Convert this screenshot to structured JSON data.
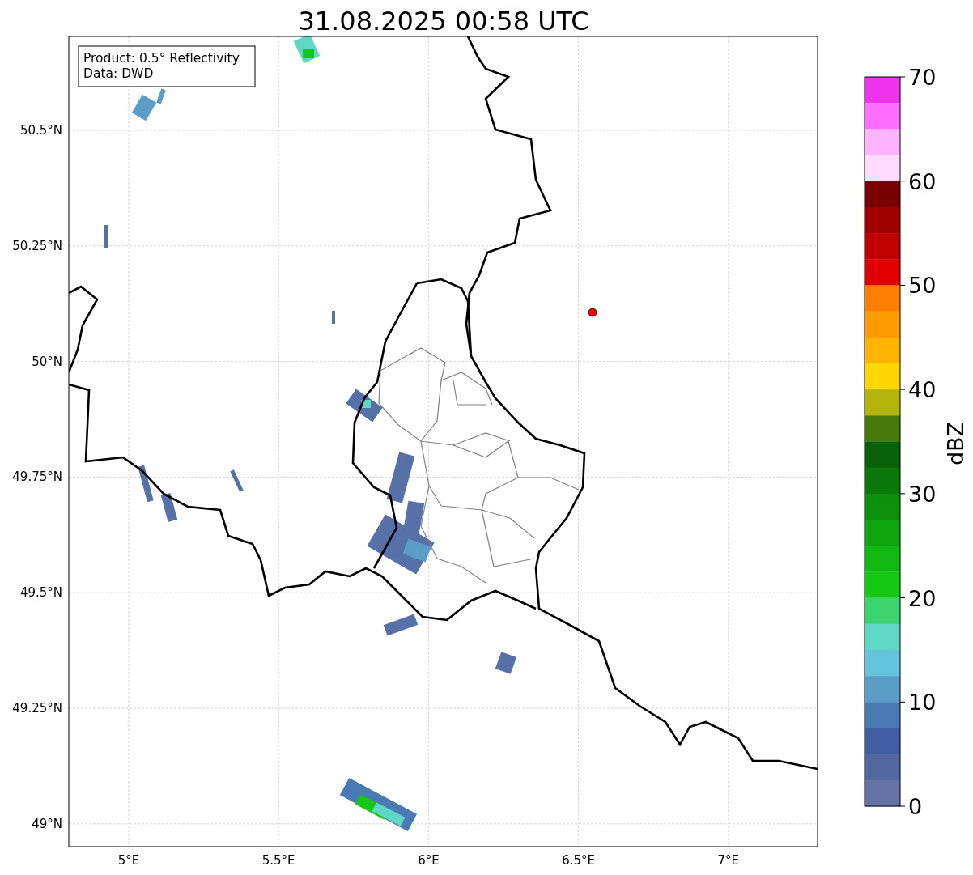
{
  "title": "31.08.2025 00:58 UTC",
  "info_box": {
    "lines": [
      "Product: 0.5° Reflectivity",
      "Data: DWD"
    ]
  },
  "map": {
    "x_ticks": [
      "5°E",
      "5.5°E",
      "6°E",
      "6.5°E",
      "7°E"
    ],
    "y_ticks": [
      "50.5°N",
      "50.25°N",
      "50°N",
      "49.75°N",
      "49.5°N",
      "49.25°N",
      "49°N"
    ]
  },
  "colorbar": {
    "label": "dBZ",
    "ticks": [
      "70",
      "60",
      "50",
      "40",
      "30",
      "20",
      "10",
      "0"
    ],
    "bins": [
      {
        "color": "#ee32ee"
      },
      {
        "color": "#ff6eff"
      },
      {
        "color": "#ffb4ff"
      },
      {
        "color": "#ffdcff"
      },
      {
        "color": "#780000"
      },
      {
        "color": "#a00000"
      },
      {
        "color": "#c00000"
      },
      {
        "color": "#e10000"
      },
      {
        "color": "#ff7d00"
      },
      {
        "color": "#ff9b00"
      },
      {
        "color": "#ffb400"
      },
      {
        "color": "#ffd700"
      },
      {
        "color": "#b4b40a"
      },
      {
        "color": "#467a0a"
      },
      {
        "color": "#086008"
      },
      {
        "color": "#0a780a"
      },
      {
        "color": "#0c900c"
      },
      {
        "color": "#0fa50f"
      },
      {
        "color": "#12b812"
      },
      {
        "color": "#14c814"
      },
      {
        "color": "#3cd46e"
      },
      {
        "color": "#5ed7c4"
      },
      {
        "color": "#64c4dc"
      },
      {
        "color": "#5a9ec8"
      },
      {
        "color": "#4a7ab4"
      },
      {
        "color": "#425ea2"
      },
      {
        "color": "#5266a0"
      },
      {
        "color": "#6473a4"
      }
    ]
  }
}
